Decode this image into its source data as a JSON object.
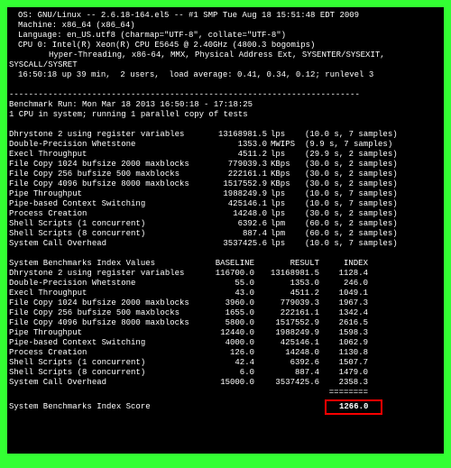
{
  "header": {
    "os": "OS: GNU/Linux -- 2.6.18-164.el5 -- #1 SMP Tue Aug 18 15:51:48 EDT 2009",
    "machine": "Machine: x86_64 (x86_64)",
    "language": "Language: en_US.utf8 (charmap=\"UTF-8\", collate=\"UTF-8\")",
    "cpu0": "CPU 0: Intel(R) Xeon(R) CPU E5645 @ 2.40GHz (4800.3 bogomips)",
    "cpu0_feat": "Hyper-Threading, x86-64, MMX, Physical Address Ext, SYSENTER/SYSEXIT,",
    "syscall": "SYSCALL/SYSRET",
    "uptime": "16:50:18 up 39 min,  2 users,  load average: 0.41, 0.34, 0.12; runlevel 3",
    "sep": "------------------------------------------------------------------------",
    "run": "Benchmark Run: Mon Mar 18 2013 16:50:18 - 17:18:25",
    "cpus": "1 CPU in system; running 1 parallel copy of tests"
  },
  "bench": [
    {
      "name": "Dhrystone 2 using register variables",
      "value": "13168981.5",
      "unit": "lps",
      "time": "(10.0 s, 7 samples)"
    },
    {
      "name": "Double-Precision Whetstone",
      "value": "1353.0",
      "unit": "MWIPS",
      "time": "(9.9 s, 7 samples)"
    },
    {
      "name": "Execl Throughput",
      "value": "4511.2",
      "unit": "lps",
      "time": "(29.9 s, 2 samples)"
    },
    {
      "name": "File Copy 1024 bufsize 2000 maxblocks",
      "value": "779039.3",
      "unit": "KBps",
      "time": "(30.0 s, 2 samples)"
    },
    {
      "name": "File Copy 256 bufsize 500 maxblocks",
      "value": "222161.1",
      "unit": "KBps",
      "time": "(30.0 s, 2 samples)"
    },
    {
      "name": "File Copy 4096 bufsize 8000 maxblocks",
      "value": "1517552.9",
      "unit": "KBps",
      "time": "(30.0 s, 2 samples)"
    },
    {
      "name": "Pipe Throughput",
      "value": "1988249.9",
      "unit": "lps",
      "time": "(10.0 s, 7 samples)"
    },
    {
      "name": "Pipe-based Context Switching",
      "value": "425146.1",
      "unit": "lps",
      "time": "(10.0 s, 7 samples)"
    },
    {
      "name": "Process Creation",
      "value": "14248.0",
      "unit": "lps",
      "time": "(30.0 s, 2 samples)"
    },
    {
      "name": "Shell Scripts (1 concurrent)",
      "value": "6392.6",
      "unit": "lpm",
      "time": "(60.0 s, 2 samples)"
    },
    {
      "name": "Shell Scripts (8 concurrent)",
      "value": "887.4",
      "unit": "lpm",
      "time": "(60.0 s, 2 samples)"
    },
    {
      "name": "System Call Overhead",
      "value": "3537425.6",
      "unit": "lps",
      "time": "(10.0 s, 7 samples)"
    }
  ],
  "index_header": {
    "name": "System Benchmarks Index Values",
    "b": "BASELINE",
    "r": "RESULT",
    "i": "INDEX"
  },
  "index": [
    {
      "name": "Dhrystone 2 using register variables",
      "b": "116700.0",
      "r": "13168981.5",
      "i": "1128.4"
    },
    {
      "name": "Double-Precision Whetstone",
      "b": "55.0",
      "r": "1353.0",
      "i": "246.0"
    },
    {
      "name": "Execl Throughput",
      "b": "43.0",
      "r": "4511.2",
      "i": "1049.1"
    },
    {
      "name": "File Copy 1024 bufsize 2000 maxblocks",
      "b": "3960.0",
      "r": "779039.3",
      "i": "1967.3"
    },
    {
      "name": "File Copy 256 bufsize 500 maxblocks",
      "b": "1655.0",
      "r": "222161.1",
      "i": "1342.4"
    },
    {
      "name": "File Copy 4096 bufsize 8000 maxblocks",
      "b": "5800.0",
      "r": "1517552.9",
      "i": "2616.5"
    },
    {
      "name": "Pipe Throughput",
      "b": "12440.0",
      "r": "1988249.9",
      "i": "1598.3"
    },
    {
      "name": "Pipe-based Context Switching",
      "b": "4000.0",
      "r": "425146.1",
      "i": "1062.9"
    },
    {
      "name": "Process Creation",
      "b": "126.0",
      "r": "14248.0",
      "i": "1130.8"
    },
    {
      "name": "Shell Scripts (1 concurrent)",
      "b": "42.4",
      "r": "6392.6",
      "i": "1507.7"
    },
    {
      "name": "Shell Scripts (8 concurrent)",
      "b": "6.0",
      "r": "887.4",
      "i": "1479.0"
    },
    {
      "name": "System Call Overhead",
      "b": "15000.0",
      "r": "3537425.6",
      "i": "2358.3"
    }
  ],
  "score_dashes": "========",
  "score": {
    "label": "System Benchmarks Index Score",
    "value": "1266.0"
  }
}
